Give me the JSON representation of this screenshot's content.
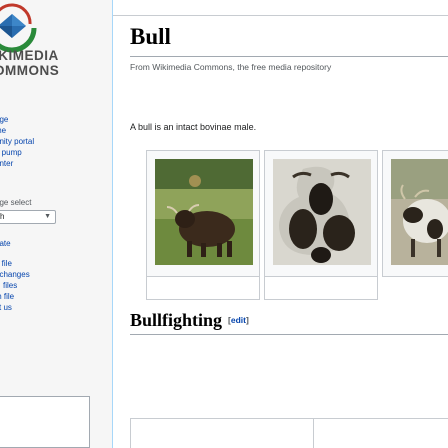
{
  "sidebar": {
    "logo": {
      "line1": "IKIMEDIA",
      "line2": "OMMONS"
    },
    "nav": [
      {
        "label": "age"
      },
      {
        "label": "me"
      },
      {
        "label": "unity portal"
      },
      {
        "label": "e pump"
      },
      {
        "label": "enter"
      }
    ],
    "language": {
      "label": "age select",
      "value": "h"
    },
    "nav2": [
      {
        "label": "pate"
      },
      {
        "label": "d file"
      },
      {
        "label": "t changes"
      },
      {
        "label": "files"
      },
      {
        "label": "m file"
      },
      {
        "label": "ct us"
      }
    ]
  },
  "page": {
    "title": "Bull",
    "tagline": "From Wikimedia Commons, the free media repository",
    "intro": "A bull is an intact bovinae male.",
    "section": {
      "heading": "Bullfighting",
      "edit_open": "[",
      "edit_label": "edit",
      "edit_close": "]"
    }
  },
  "colors": {
    "link": "#0645ad",
    "border": "#a2a9b1",
    "text": "#202122",
    "muted": "#54595d"
  }
}
